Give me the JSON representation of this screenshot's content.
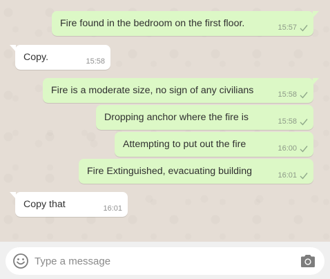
{
  "messages": [
    {
      "direction": "out",
      "text": "Fire found in the bedroom on the first floor.",
      "time": "15:57"
    },
    {
      "direction": "in",
      "text": "Copy.",
      "time": "15:58"
    },
    {
      "direction": "out",
      "text": "Fire is a moderate size, no sign of any civilians",
      "time": "15:58"
    },
    {
      "direction": "out",
      "text": "Dropping anchor where the fire is",
      "time": "15:58"
    },
    {
      "direction": "out",
      "text": "Attempting to put out the fire",
      "time": "16:00"
    },
    {
      "direction": "out",
      "text": "Fire Extinguished, evacuating building",
      "time": "16:01"
    },
    {
      "direction": "in",
      "text": "Copy that",
      "time": "16:01"
    }
  ],
  "composer": {
    "placeholder": "Type a message",
    "emoji_icon": "smiley-icon",
    "camera_icon": "camera-icon"
  },
  "colors": {
    "outgoing_bubble": "#dcf8c6",
    "incoming_bubble": "#ffffff",
    "chat_background": "#e5ddd5",
    "tick": "#8fa88a"
  }
}
